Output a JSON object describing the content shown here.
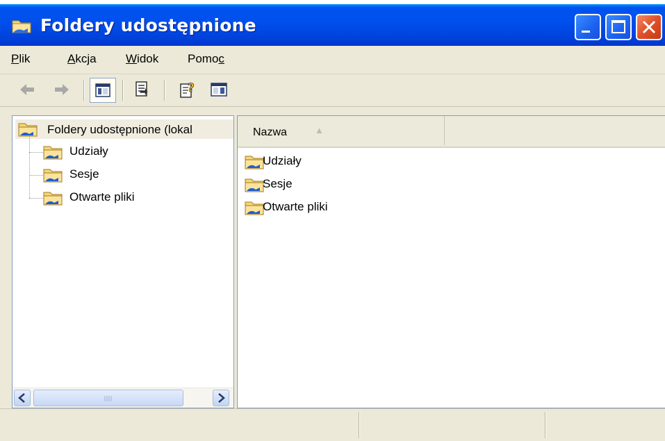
{
  "window": {
    "title": "Foldery udostępnione"
  },
  "menu": [
    {
      "label_first": "P",
      "label_rest": "lik"
    },
    {
      "label_first": "A",
      "label_rest": "kcja"
    },
    {
      "label_first": "W",
      "label_rest": "idok"
    },
    {
      "label_pre": "Pomo",
      "label_last": "c"
    }
  ],
  "toolbar": {
    "icons": [
      "back-icon",
      "forward-icon",
      "show-hide-tree-icon",
      "export-list-icon",
      "help-icon",
      "show-hide-action-pane-icon"
    ]
  },
  "tree": {
    "root": "Foldery udostępnione (lokal",
    "children": [
      "Udziały",
      "Sesje",
      "Otwarte pliki"
    ]
  },
  "list": {
    "column_name": "Nazwa",
    "sort_indicator": "▲",
    "items": [
      "Udziały",
      "Sesje",
      "Otwarte pliki"
    ]
  },
  "scrollbar": {
    "left_arrow": "<",
    "right_arrow": ">"
  },
  "colors": {
    "titlebar": "#0050ee",
    "chrome": "#ece9d8",
    "close": "#e0502a"
  }
}
